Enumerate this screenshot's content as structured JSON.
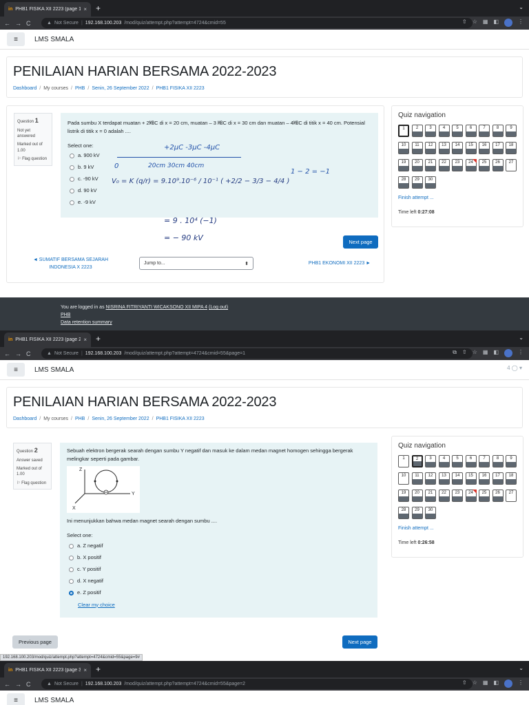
{
  "browser": {
    "tabs": [
      {
        "favicon": "in",
        "title": "PHB1 FISIKA XII 2223 (page 1 o",
        "close": "×"
      },
      {
        "favicon": "in",
        "title": "PHB1 FISIKA XII 2223 (page 2 o",
        "close": "×"
      },
      {
        "favicon": "in",
        "title": "PHB1 FISIKA XII 2223 (page 3 o",
        "close": "×"
      }
    ],
    "new_tab": "+",
    "security_label": "Not Secure",
    "host": "192.168.100.203",
    "paths": [
      "/mod/quiz/attempt.php?attempt=4724&cmid=55",
      "/mod/quiz/attempt.php?attempt=4724&cmid=55&page=1",
      "/mod/quiz/attempt.php?attempt=4724&cmid=55&page=2"
    ],
    "statusbar_url": "192.168.100.203/mod/quiz/attempt.php?attempt=4724&cmid=55&page=9#"
  },
  "site": {
    "brand": "LMS SMALA",
    "user_fragment": "4"
  },
  "page": {
    "title": "PENILAIAN HARIAN BERSAMA 2022-2023",
    "breadcrumbs": [
      "Dashboard",
      "My courses",
      "PHB",
      "Senin, 26 September 2022",
      "PHB1 FISIKA XII 2223"
    ]
  },
  "q1": {
    "label": "Question",
    "number": "1",
    "state": "Not yet answered",
    "marked": "Marked out of 1.00",
    "flag": "Flag question",
    "text": "Pada sumbu X terdapat muatan  + 2㎆C di x = 20 cm, muatan – 3 ㎆C di x = 30 cm dan muatan – 4㎆C di titik x = 40 cm. Potensial listrik di titik x = 0 adalah ....",
    "select": "Select one:",
    "options": [
      "a. 900 kV",
      "b. 9 kV",
      "c. -90 kV",
      "d. 90 kV",
      "e. -9 kV"
    ],
    "next": "Next page",
    "prev_link": "◄ SUMATIF BERSAMA SEJARAH INDONESIA X 2223",
    "jump": "Jump to...",
    "next_link": "PHB1 EKONOMI XII 2223 ►"
  },
  "handwriting": {
    "charges": "+2μC   -3μC   -4μC",
    "zero": "0",
    "positions": "20cm   30cm   40cm",
    "v0": "V₀ = K (q/r) = 9.10⁹.10⁻⁶ / 10⁻¹ ( +2/2 − 3/3 − 4/4 )",
    "side": "1 − 2 = −1",
    "line2": "= 9 . 10⁴ (−1)",
    "line3": "= − 90 kV"
  },
  "q2": {
    "label": "Question",
    "number": "2",
    "state": "Answer saved",
    "marked": "Marked out of 1.00",
    "flag": "Flag question",
    "text": "Sebuah elektron bergerak searah dengan sumbu Y negatif dan masuk ke dalam medan magnet homogen sehingga bergerak melingkar seperti pada gambar.",
    "figure_labels": {
      "z": "Z",
      "y": "Y",
      "x": "X"
    },
    "text2": "Ini menunjukkan bahwa medan magnet searah dengan sumbu ....",
    "select": "Select one:",
    "options": [
      "a. Z negatif",
      "b. X positif",
      "c. Y positif",
      "d. X negatif",
      "e. Z positif"
    ],
    "selected_index": 4,
    "clear": "Clear my choice",
    "prev": "Previous page",
    "next": "Next page"
  },
  "quiz_nav": {
    "title": "Quiz navigation",
    "numbers": [
      "1",
      "2",
      "3",
      "4",
      "5",
      "6",
      "7",
      "8",
      "9",
      "10",
      "11",
      "12",
      "13",
      "14",
      "15",
      "16",
      "17",
      "18",
      "19",
      "20",
      "21",
      "22",
      "23",
      "24",
      "25",
      "26",
      "27",
      "28",
      "29",
      "30"
    ],
    "finish": "Finish attempt ...",
    "time_label": "Time left",
    "time_1": "0:27:08",
    "time_2": "0:26:58"
  },
  "footer": {
    "logged_prefix": "You are logged in as",
    "user": "NISRINA FITRIYANTI WICAKSONO XII MIPA 4",
    "logout": "(Log out)",
    "links": [
      "PHB",
      "Data retention summary"
    ]
  },
  "colors": {
    "primary": "#0f6cbf",
    "question_bg": "#e7f3f5",
    "footer": "#343a40",
    "chrome": "#202124"
  }
}
